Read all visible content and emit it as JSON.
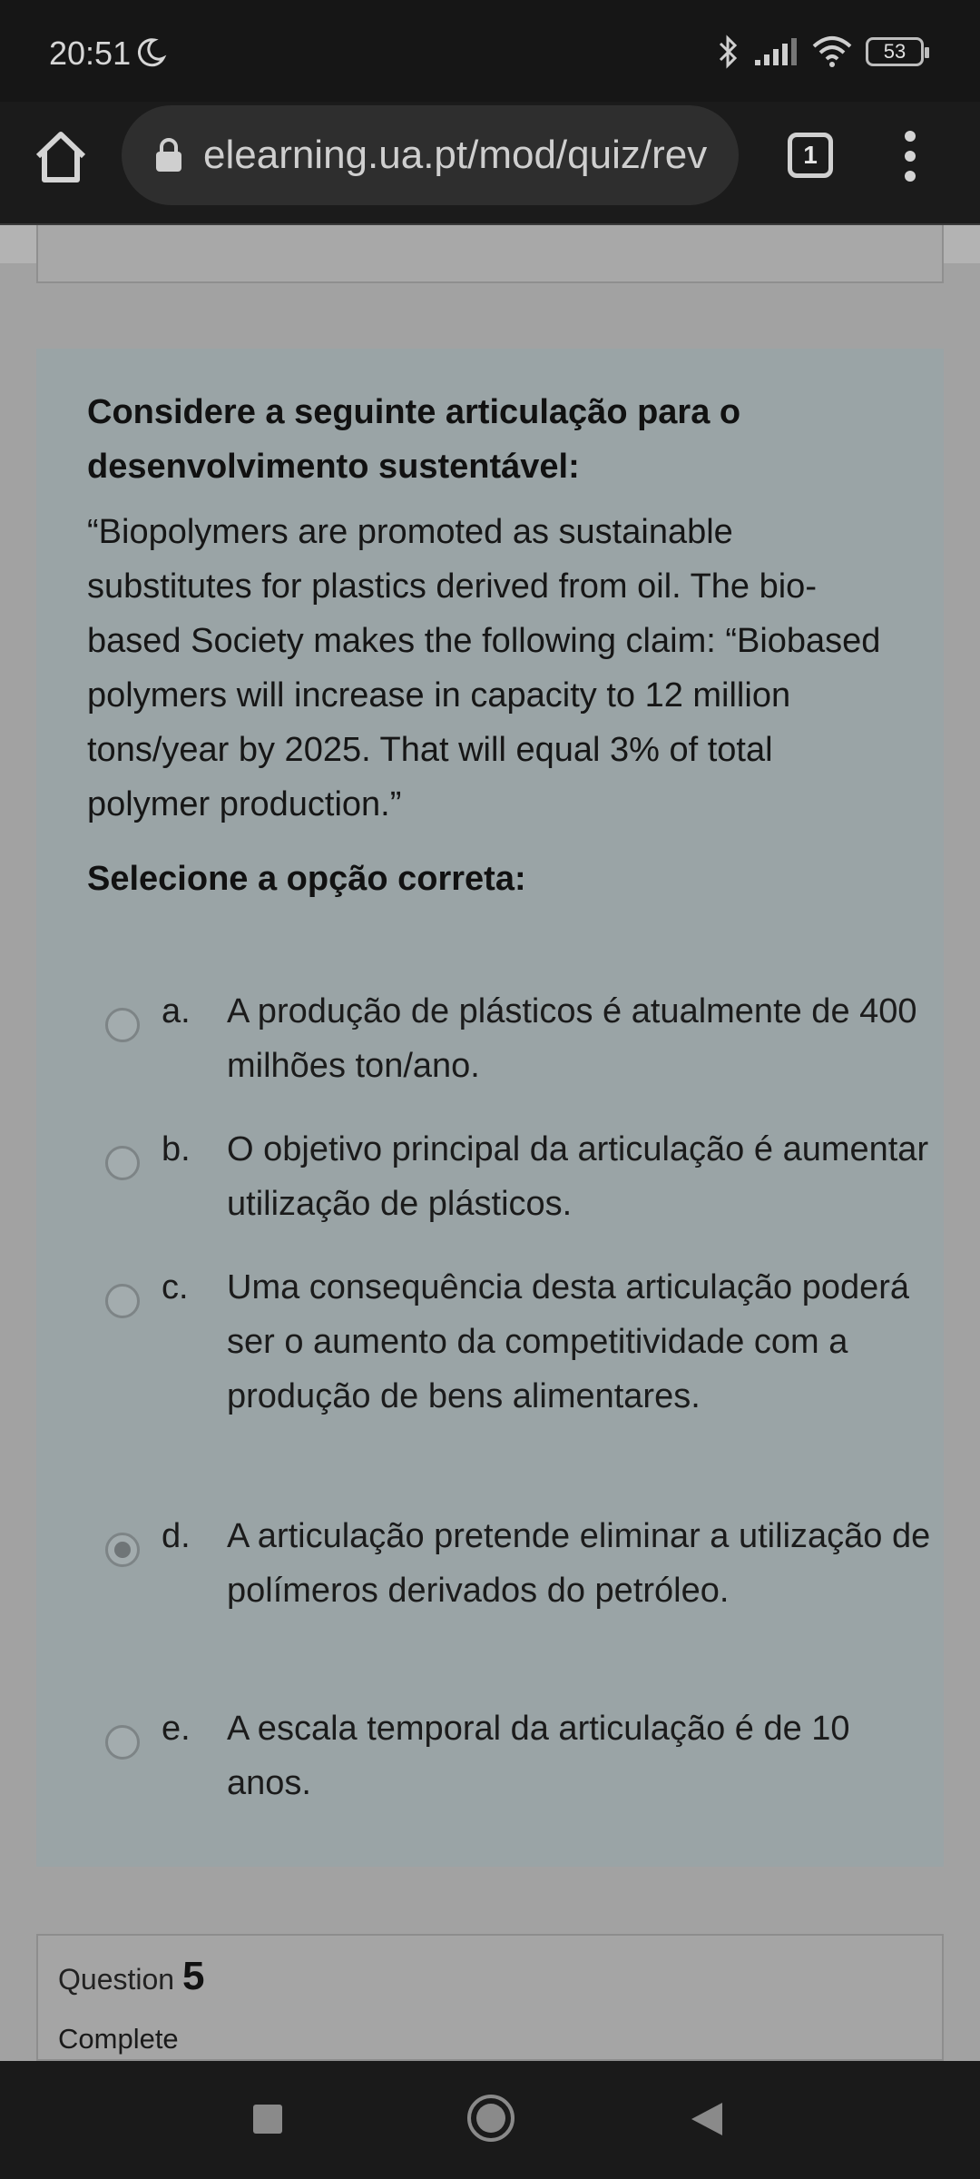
{
  "status_bar": {
    "time": "20:51",
    "battery": "53",
    "icons": [
      "moon-icon",
      "bluetooth-icon",
      "signal-icon",
      "wifi-icon",
      "battery-icon"
    ]
  },
  "browser": {
    "url": "elearning.ua.pt/mod/quiz/rev",
    "tab_count": "1"
  },
  "question": {
    "title": "Considere a seguinte articulação para o desenvolvimento sustentável:",
    "body": "“Biopolymers are promoted as sustainable substitutes for plastics derived from oil. The bio-based Society makes the following claim: “Biobased polymers will increase in capacity to 12 million tons/year by 2025. That will equal 3% of total polymer production.”",
    "select_label": "Selecione a opção correta:",
    "options": [
      {
        "letter": "a.",
        "text": "A produção de plásticos é atualmente de 400 milhões ton/ano.",
        "selected": false
      },
      {
        "letter": "b.",
        "text": "O objetivo principal da articulação é aumentar utilização de plásticos.",
        "selected": false
      },
      {
        "letter": "c.",
        "text": "Uma consequência desta articulação poderá ser o aumento da competitividade com a produção de bens alimentares.",
        "selected": false
      },
      {
        "letter": "d.",
        "text": "A articulação pretende eliminar a utilização de polímeros derivados do petróleo.",
        "selected": true
      },
      {
        "letter": "e.",
        "text": "A escala temporal da articulação é de 10 anos.",
        "selected": false
      }
    ]
  },
  "next_question": {
    "label": "Question",
    "number": "5",
    "status": "Complete"
  },
  "nav": {
    "icons": [
      "recents-square-icon",
      "home-circle-icon",
      "back-triangle-icon"
    ]
  }
}
